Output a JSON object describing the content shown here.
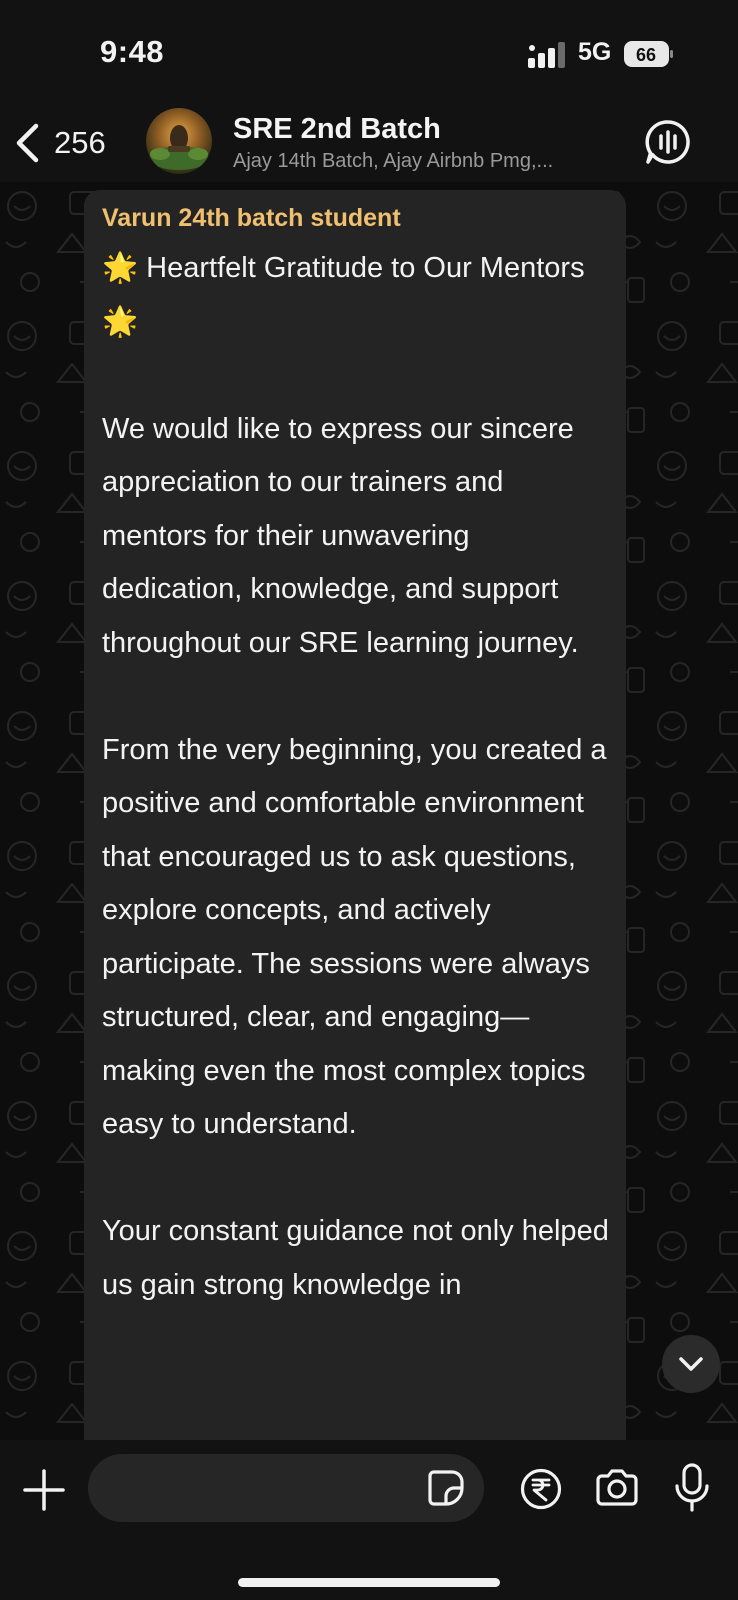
{
  "status_bar": {
    "time": "9:48",
    "network": "5G",
    "battery": "66"
  },
  "header": {
    "back_count": "256",
    "title": "SRE 2nd Batch",
    "subtitle": "Ajay 14th Batch, Ajay Airbnb Pmg,..."
  },
  "message": {
    "sender": "Varun 24th batch student",
    "title_line": "🌟 Heartfelt Gratitude to Our Mentors 🌟",
    "paragraphs": [
      "We would like to express our sincere appreciation to our trainers and mentors for their unwavering dedication, knowledge, and support throughout our SRE learning journey.",
      "From the very beginning, you created a positive and comfortable environment that encouraged us to ask questions, explore concepts, and actively participate. The sessions were always structured, clear, and engaging—making even the most complex topics easy to understand.",
      "Your constant guidance not only helped us gain strong knowledge in"
    ]
  },
  "composer": {
    "input_value": ""
  },
  "colors": {
    "sender": "#f0c070",
    "bubble": "#242424",
    "background": "#0b0b0b"
  },
  "icons": [
    "chevron-left-icon",
    "voice-call-icon",
    "chevron-down-icon",
    "plus-icon",
    "sticker-icon",
    "rupee-icon",
    "camera-icon",
    "mic-icon"
  ]
}
